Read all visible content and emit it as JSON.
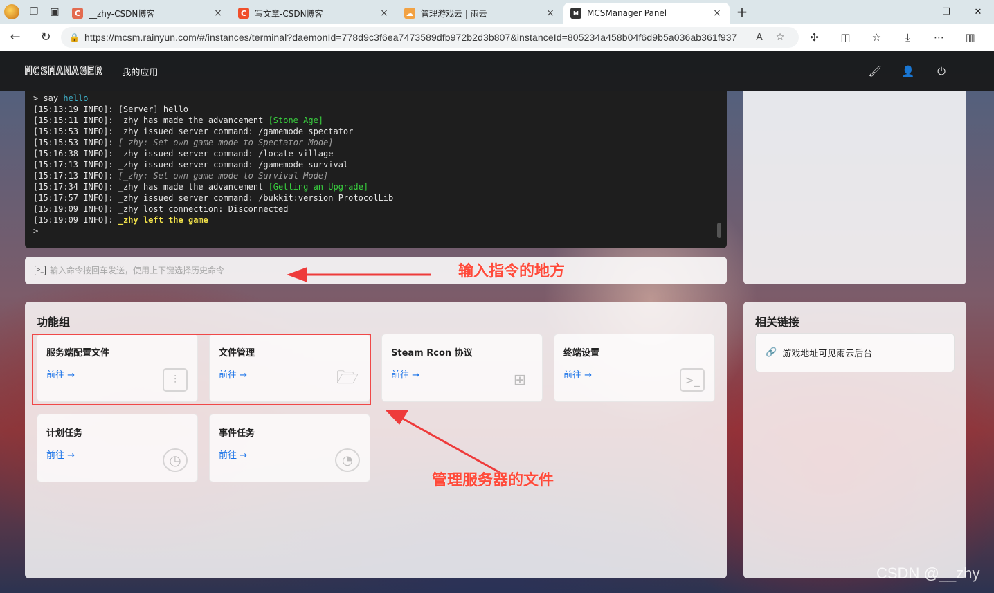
{
  "browser": {
    "tabs": [
      {
        "title": "__zhy-CSDN博客",
        "fav_letter": "C",
        "fav_color": "#e36b50"
      },
      {
        "title": "写文章-CSDN博客",
        "fav_letter": "C",
        "fav_color": "#f04f2b"
      },
      {
        "title": "管理游戏云 | 雨云",
        "fav_letter": "☁",
        "fav_color": "#f2a243"
      },
      {
        "title": "MCSManager Panel",
        "fav_letter": "M",
        "fav_color": "#333333"
      }
    ],
    "url": "https://mcsm.rainyun.com/#/instances/terminal?daemonId=778d9c3f6ea7473589dfb972b2d3b807&instanceId=805234a458b04f6d9b5a036ab361f937"
  },
  "header": {
    "logo": "MCSMANAGER",
    "nav_item": "我的应用"
  },
  "console": {
    "lines": [
      {
        "parts": [
          {
            "t": "> say "
          },
          {
            "t": "hello",
            "c": "cyan"
          }
        ]
      },
      {
        "parts": [
          {
            "t": "[15:13:19 INFO]: [Server] hello"
          }
        ]
      },
      {
        "parts": [
          {
            "t": "[15:15:11 INFO]: _zhy has made the advancement "
          },
          {
            "t": "[Stone Age]",
            "c": "green"
          }
        ]
      },
      {
        "parts": [
          {
            "t": "[15:15:53 INFO]: _zhy issued server command: /gamemode spectator"
          }
        ]
      },
      {
        "parts": [
          {
            "t": "[15:15:53 INFO]: "
          },
          {
            "t": "[_zhy: Set own game mode to Spectator Mode]",
            "c": "ital"
          }
        ]
      },
      {
        "parts": [
          {
            "t": "[15:16:38 INFO]: _zhy issued server command: /locate village"
          }
        ]
      },
      {
        "parts": [
          {
            "t": "[15:17:13 INFO]: _zhy issued server command: /gamemode survival"
          }
        ]
      },
      {
        "parts": [
          {
            "t": "[15:17:13 INFO]: "
          },
          {
            "t": "[_zhy: Set own game mode to Survival Mode]",
            "c": "ital"
          }
        ]
      },
      {
        "parts": [
          {
            "t": "[15:17:34 INFO]: _zhy has made the advancement "
          },
          {
            "t": "[Getting an Upgrade]",
            "c": "green"
          }
        ]
      },
      {
        "parts": [
          {
            "t": "[15:17:57 INFO]: _zhy issued server command: /bukkit:version ProtocolLib"
          }
        ]
      },
      {
        "parts": [
          {
            "t": "[15:19:09 INFO]: _zhy lost connection: Disconnected"
          }
        ]
      },
      {
        "parts": [
          {
            "t": "[15:19:09 INFO]: "
          },
          {
            "t": "_zhy left the game",
            "c": "yel"
          }
        ]
      },
      {
        "parts": [
          {
            "t": ">"
          }
        ]
      }
    ]
  },
  "command_input": {
    "placeholder": "输入命令按回车发送，使用上下键选择历史命令"
  },
  "function_group": {
    "title": "功能组",
    "go_label": "前往 →",
    "items": [
      {
        "title": "服务端配置文件",
        "icon": "sliders-icon"
      },
      {
        "title": "文件管理",
        "icon": "folder-open-icon"
      },
      {
        "title": "Steam Rcon 协议",
        "icon": "blocks-icon"
      },
      {
        "title": "终端设置",
        "icon": "terminal-icon"
      },
      {
        "title": "计划任务",
        "icon": "clock-icon"
      },
      {
        "title": "事件任务",
        "icon": "dashboard-icon"
      }
    ]
  },
  "related_links": {
    "title": "相关链接",
    "items": [
      {
        "label": "游戏地址可见雨云后台"
      }
    ]
  },
  "annotations": {
    "input_note": "输入指令的地方",
    "files_note": "管理服务器的文件",
    "watermark": "CSDN @__zhy",
    "color": "#ff4a3a"
  }
}
